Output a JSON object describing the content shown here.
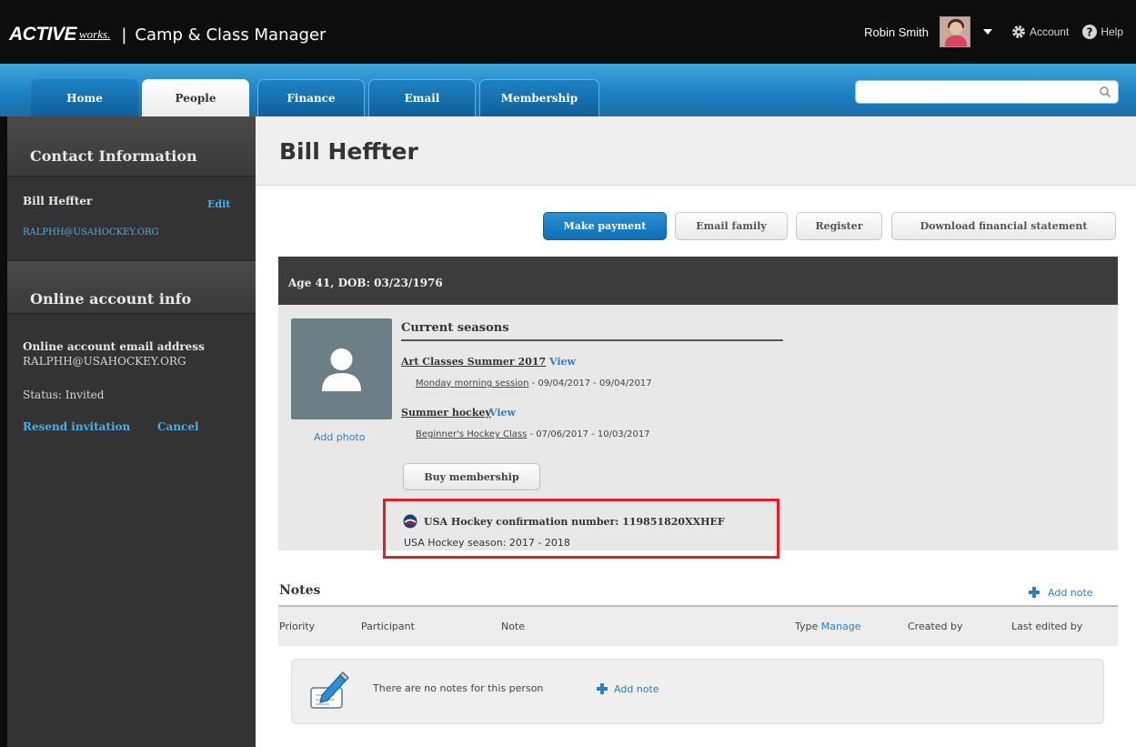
{
  "topbar": {
    "brand_active": "ACTIVE",
    "brand_works": "works.",
    "separator": "|",
    "app_title": "Camp & Class Manager",
    "user_name": "Robin Smith",
    "account_label": "Account",
    "help_label": "Help",
    "icons": [
      "avatar",
      "chevron-down-icon",
      "gear-icon",
      "help-icon"
    ]
  },
  "nav": {
    "tabs": [
      {
        "label": "Home",
        "active": false
      },
      {
        "label": "People",
        "active": true
      },
      {
        "label": "Finance",
        "active": false
      },
      {
        "label": "Email",
        "active": false
      },
      {
        "label": "Membership",
        "active": false
      }
    ],
    "search": {
      "value": "",
      "placeholder": ""
    },
    "search_icon": "search-icon"
  },
  "sidebar": {
    "contact_header": "Contact Information",
    "contact_name": "Bill Heffter",
    "edit_label": "Edit",
    "contact_email": "RALPHH@USAHOCKEY.ORG",
    "online_header": "Online account info",
    "online_email_label": "Online account email address",
    "online_email": "RALPHH@USAHOCKEY.ORG",
    "status": "Status: Invited",
    "resend_label": "Resend invitation",
    "cancel_label": "Cancel"
  },
  "main": {
    "page_title": "Bill Heffter",
    "buttons": {
      "make_payment": "Make payment",
      "email_family": "Email family",
      "register": "Register",
      "download_statement": "Download financial statement"
    },
    "info_bar": "Age 41, DOB: 03/23/1976",
    "add_photo": "Add photo",
    "current_seasons_title": "Current seasons",
    "seasons": [
      {
        "name": "Art Classes Summer 2017",
        "view_label": "View",
        "session_name": "Monday morning session",
        "session_dates": " - 09/04/2017 - 09/04/2017"
      },
      {
        "name": "Summer hockey",
        "view_label": "View",
        "session_name": "Beginner's Hockey Class",
        "session_dates": " - 07/06/2017 - 10/03/2017"
      }
    ],
    "buy_membership": "Buy membership",
    "usa_hockey": {
      "confirmation_text": "USA Hockey confirmation number: 119851820XXHEF",
      "season_text": "USA Hockey season: 2017 - 2018",
      "highlight_color": "#e02027"
    },
    "notes": {
      "title": "Notes",
      "add_note": "Add note",
      "columns": {
        "priority": "Priority",
        "participant": "Participant",
        "note": "Note",
        "type": "Type",
        "manage": "Manage",
        "created_by": "Created by",
        "last_edited_by": "Last edited by"
      },
      "empty_text": "There are no notes for this person",
      "add_note_inline": "Add note"
    }
  },
  "colors": {
    "topbar_bg": "#0d0d0d",
    "nav_blue": "#1b7fc0",
    "sidebar_bg": "#333333",
    "link_blue": "#2c7fc0",
    "primary_button": "#0f6fb5"
  }
}
